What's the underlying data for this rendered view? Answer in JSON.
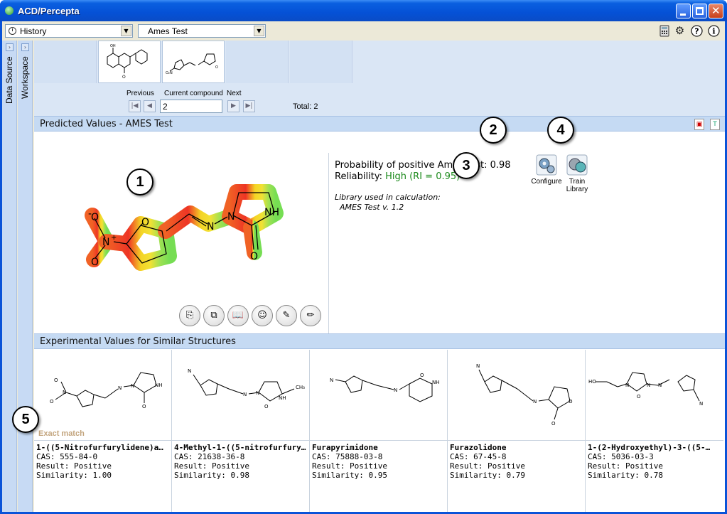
{
  "window": {
    "title": "ACD/Percepta"
  },
  "toolbar": {
    "history_label": "History",
    "test_label": "Ames Test",
    "icons": [
      "calculator-icon",
      "gear-icon",
      "help-icon",
      "info-icon"
    ]
  },
  "side_panels": {
    "data_source": "Data Source",
    "workspace": "Workspace"
  },
  "navigator": {
    "previous_label": "Previous",
    "current_label": "Current compound",
    "next_label": "Next",
    "current_value": "2",
    "total_label": "Total: 2"
  },
  "predicted": {
    "header": "Predicted Values - AMES Test",
    "probability_label": "Probability of positive Ames test:",
    "probability_value": "0.98",
    "reliability_label": "Reliability:",
    "reliability_value": "High (RI = 0.95)",
    "library_label": "Library used in calculation:",
    "library_value": "AMES Test v. 1.2",
    "configure_label": "Configure",
    "train_label_1": "Train",
    "train_label_2": "Library",
    "molecule_atoms": {
      "minus": "-",
      "o_plus": "O",
      "n_plus": "N",
      "plus": "+",
      "o_ring": "O",
      "n1": "N",
      "n2": "N",
      "nh": "NH",
      "o_carbonyl": "O"
    }
  },
  "callouts": [
    "1",
    "2",
    "3",
    "4",
    "5"
  ],
  "colors": {
    "accent": "#c5daf3",
    "green": "#1c8a1c",
    "exact_match": "#c3a57e"
  },
  "similar": {
    "header": "Experimental Values for Similar Structures",
    "exact_match": "Exact match",
    "items": [
      {
        "name": "1-((5-Nitrofurfurylidene)a…",
        "cas": "CAS: 555-84-0",
        "result": "Result: Positive",
        "similarity": "Similarity: 1.00"
      },
      {
        "name": "4-Methyl-1-((5-nitrofurfury…",
        "cas": "CAS: 21638-36-8",
        "result": "Result: Positive",
        "similarity": "Similarity: 0.98"
      },
      {
        "name": "Furapyrimidone",
        "cas": "CAS: 75888-03-8",
        "result": "Result: Positive",
        "similarity": "Similarity: 0.95"
      },
      {
        "name": "Furazolidone",
        "cas": "CAS: 67-45-8",
        "result": "Result: Positive",
        "similarity": "Similarity: 0.79"
      },
      {
        "name": "1-(2-Hydroxyethyl)-3-((5-…",
        "cas": "CAS: 5036-03-3",
        "result": "Result: Positive",
        "similarity": "Similarity: 0.78"
      }
    ]
  }
}
